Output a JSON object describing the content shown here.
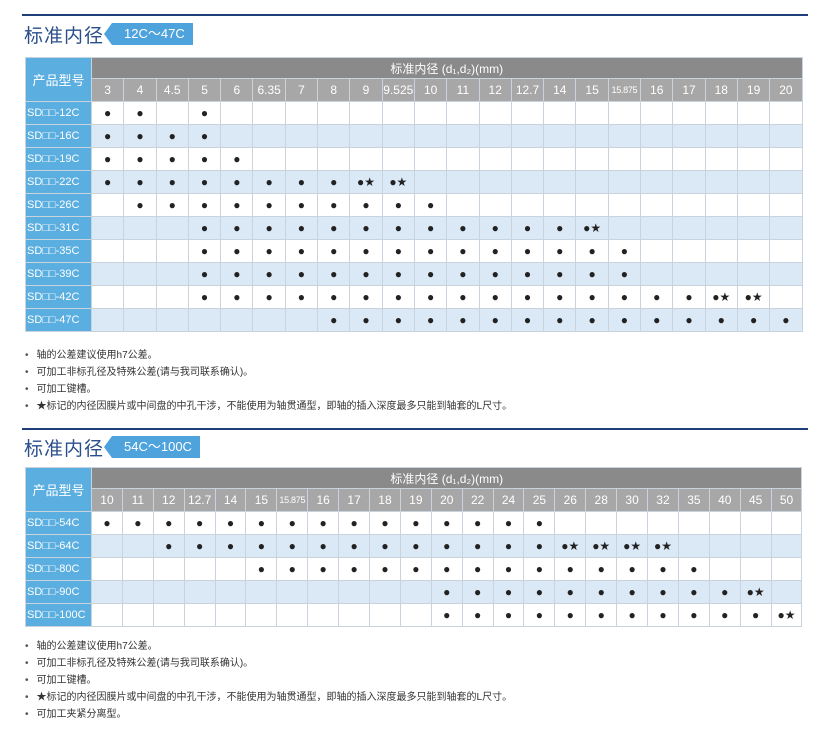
{
  "section1": {
    "title": "标准内径",
    "range": "12C～47C",
    "header_name": "产品型号",
    "header_top": "标准内径 (d₁,d₂)(mm)",
    "sizes": [
      "3",
      "4",
      "4.5",
      "5",
      "6",
      "6.35",
      "7",
      "8",
      "9",
      "9.525",
      "10",
      "11",
      "12",
      "12.7",
      "14",
      "15",
      "15.875",
      "16",
      "17",
      "18",
      "19",
      "20"
    ],
    "rows": [
      {
        "model": "SD□□-12C",
        "cells": [
          "●",
          "●",
          "",
          "●",
          "",
          "",
          "",
          "",
          "",
          "",
          "",
          "",
          "",
          "",
          "",
          "",
          "",
          "",
          "",
          "",
          "",
          ""
        ]
      },
      {
        "model": "SD□□-16C",
        "cells": [
          "●",
          "●",
          "●",
          "●",
          "",
          "",
          "",
          "",
          "",
          "",
          "",
          "",
          "",
          "",
          "",
          "",
          "",
          "",
          "",
          "",
          "",
          ""
        ]
      },
      {
        "model": "SD□□-19C",
        "cells": [
          "●",
          "●",
          "●",
          "●",
          "●",
          "",
          "",
          "",
          "",
          "",
          "",
          "",
          "",
          "",
          "",
          "",
          "",
          "",
          "",
          "",
          "",
          ""
        ]
      },
      {
        "model": "SD□□-22C",
        "cells": [
          "●",
          "●",
          "●",
          "●",
          "●",
          "●",
          "●",
          "●",
          "●★",
          "●★",
          "",
          "",
          "",
          "",
          "",
          "",
          "",
          "",
          "",
          "",
          "",
          ""
        ]
      },
      {
        "model": "SD□□-26C",
        "cells": [
          "",
          "●",
          "●",
          "●",
          "●",
          "●",
          "●",
          "●",
          "●",
          "●",
          "●",
          "",
          "",
          "",
          "",
          "",
          "",
          "",
          "",
          "",
          "",
          ""
        ]
      },
      {
        "model": "SD□□-31C",
        "cells": [
          "",
          "",
          "",
          "●",
          "●",
          "●",
          "●",
          "●",
          "●",
          "●",
          "●",
          "●",
          "●",
          "●",
          "●",
          "●★",
          "",
          "",
          "",
          "",
          "",
          ""
        ]
      },
      {
        "model": "SD□□-35C",
        "cells": [
          "",
          "",
          "",
          "●",
          "●",
          "●",
          "●",
          "●",
          "●",
          "●",
          "●",
          "●",
          "●",
          "●",
          "●",
          "●",
          "●",
          "",
          "",
          "",
          "",
          ""
        ]
      },
      {
        "model": "SD□□-39C",
        "cells": [
          "",
          "",
          "",
          "●",
          "●",
          "●",
          "●",
          "●",
          "●",
          "●",
          "●",
          "●",
          "●",
          "●",
          "●",
          "●",
          "●",
          "",
          "",
          "",
          "",
          ""
        ]
      },
      {
        "model": "SD□□-42C",
        "cells": [
          "",
          "",
          "",
          "●",
          "●",
          "●",
          "●",
          "●",
          "●",
          "●",
          "●",
          "●",
          "●",
          "●",
          "●",
          "●",
          "●",
          "●",
          "●",
          "●★",
          "●★",
          ""
        ]
      },
      {
        "model": "SD□□-47C",
        "cells": [
          "",
          "",
          "",
          "",
          "",
          "",
          "",
          "●",
          "●",
          "●",
          "●",
          "●",
          "●",
          "●",
          "●",
          "●",
          "●",
          "●",
          "●",
          "●",
          "●",
          "●"
        ]
      }
    ],
    "notes": [
      "轴的公差建议使用h7公差。",
      "可加工非标孔径及特殊公差(请与我司联系确认)。",
      "可加工键槽。",
      "★标记的内径因膜片或中间盘的中孔干涉，不能使用为轴贯通型，即轴的插入深度最多只能到轴套的L尺寸。"
    ]
  },
  "section2": {
    "title": "标准内径",
    "range": "54C～100C",
    "header_name": "产品型号",
    "header_top": "标准内径 (d₁,d₂)(mm)",
    "sizes": [
      "10",
      "11",
      "12",
      "12.7",
      "14",
      "15",
      "15.875",
      "16",
      "17",
      "18",
      "19",
      "20",
      "22",
      "24",
      "25",
      "26",
      "28",
      "30",
      "32",
      "35",
      "40",
      "45",
      "50"
    ],
    "rows": [
      {
        "model": "SD□□-54C",
        "cells": [
          "●",
          "●",
          "●",
          "●",
          "●",
          "●",
          "●",
          "●",
          "●",
          "●",
          "●",
          "●",
          "●",
          "●",
          "●",
          "",
          "",
          "",
          "",
          "",
          "",
          "",
          ""
        ]
      },
      {
        "model": "SD□□-64C",
        "cells": [
          "",
          "",
          "●",
          "●",
          "●",
          "●",
          "●",
          "●",
          "●",
          "●",
          "●",
          "●",
          "●",
          "●",
          "●",
          "●★",
          "●★",
          "●★",
          "●★",
          "",
          "",
          "",
          ""
        ]
      },
      {
        "model": "SD□□-80C",
        "cells": [
          "",
          "",
          "",
          "",
          "",
          "●",
          "●",
          "●",
          "●",
          "●",
          "●",
          "●",
          "●",
          "●",
          "●",
          "●",
          "●",
          "●",
          "●",
          "●",
          "",
          "",
          ""
        ]
      },
      {
        "model": "SD□□-90C",
        "cells": [
          "",
          "",
          "",
          "",
          "",
          "",
          "",
          "",
          "",
          "",
          "",
          "●",
          "●",
          "●",
          "●",
          "●",
          "●",
          "●",
          "●",
          "●",
          "●",
          "●★",
          ""
        ]
      },
      {
        "model": "SD□□-100C",
        "cells": [
          "",
          "",
          "",
          "",
          "",
          "",
          "",
          "",
          "",
          "",
          "",
          "●",
          "●",
          "●",
          "●",
          "●",
          "●",
          "●",
          "●",
          "●",
          "●",
          "●",
          "●★"
        ]
      }
    ],
    "notes": [
      "轴的公差建议使用h7公差。",
      "可加工非标孔径及特殊公差(请与我司联系确认)。",
      "可加工键槽。",
      "★标记的内径因膜片或中间盘的中孔干涉，不能使用为轴贯通型，即轴的插入深度最多只能到轴套的L尺寸。",
      "可加工夹紧分离型。"
    ]
  }
}
